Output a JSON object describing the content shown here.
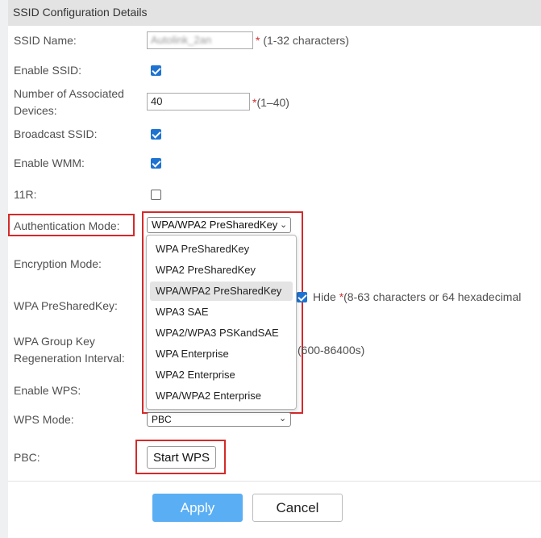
{
  "header": {
    "title": "SSID Configuration Details"
  },
  "fields": {
    "ssid_name": {
      "label": "SSID Name:",
      "value": "Autolink_2an",
      "hint_star": "*",
      "hint": " (1-32 characters)"
    },
    "enable_ssid": {
      "label": "Enable SSID:",
      "checked": true
    },
    "associated_devices": {
      "label_line1": "Number of Associated",
      "label_line2": "Devices:",
      "value": "40",
      "hint_star": "*",
      "hint": "(1–40)"
    },
    "broadcast_ssid": {
      "label": "Broadcast SSID:",
      "checked": true
    },
    "enable_wmm": {
      "label": "Enable WMM:",
      "checked": true
    },
    "r11": {
      "label": "11R:",
      "checked": false
    },
    "auth_mode": {
      "label": "Authentication Mode:",
      "selected": "WPA/WPA2 PreSharedKey"
    },
    "encryption_mode": {
      "label": "Encryption Mode:"
    },
    "wpa_psk": {
      "label": "WPA PreSharedKey:",
      "hide_label": "Hide",
      "hint_star": "*",
      "hint": "(8-63 characters or 64 hexadecimal"
    },
    "wpa_group_key": {
      "label_line1": "WPA Group Key",
      "label_line2": "Regeneration Interval:",
      "hint": "(600-86400s)"
    },
    "enable_wps": {
      "label": "Enable WPS:"
    },
    "wps_mode": {
      "label": "WPS Mode:",
      "selected": "PBC"
    },
    "pbc": {
      "label": "PBC:",
      "button": "Start WPS"
    }
  },
  "auth_options": [
    "WPA PreSharedKey",
    "WPA2 PreSharedKey",
    "WPA/WPA2 PreSharedKey",
    "WPA3 SAE",
    "WPA2/WPA3 PSKandSAE",
    "WPA Enterprise",
    "WPA2 Enterprise",
    "WPA/WPA2 Enterprise"
  ],
  "actions": {
    "apply": "Apply",
    "cancel": "Cancel"
  },
  "colors": {
    "accent": "#1e73d1",
    "apply_bg": "#5aaef3",
    "highlight": "#d42a2a",
    "required": "#d03030"
  }
}
